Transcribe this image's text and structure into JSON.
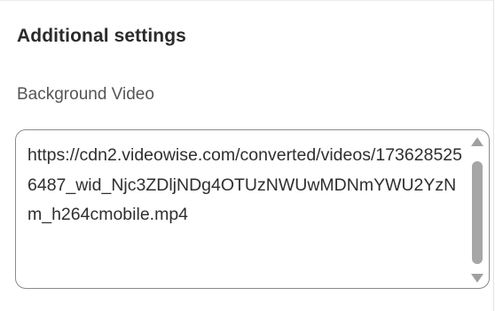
{
  "section": {
    "title": "Additional settings"
  },
  "background_video": {
    "label": "Background Video",
    "value": "https://cdn2.videowise.com/converted/videos/1736285256487_wid_Njc3ZDljNDg4OTUzNWUwMDNmYWU2YzNm_h264cmobile.mp4"
  },
  "icons": {
    "scroll_up": "chevron-up-icon",
    "scroll_down": "chevron-down-icon"
  },
  "colors": {
    "border": "#8a8a8a",
    "text": "#2f2f2f",
    "label": "#555555",
    "scrollbar": "#a6a6a6"
  }
}
